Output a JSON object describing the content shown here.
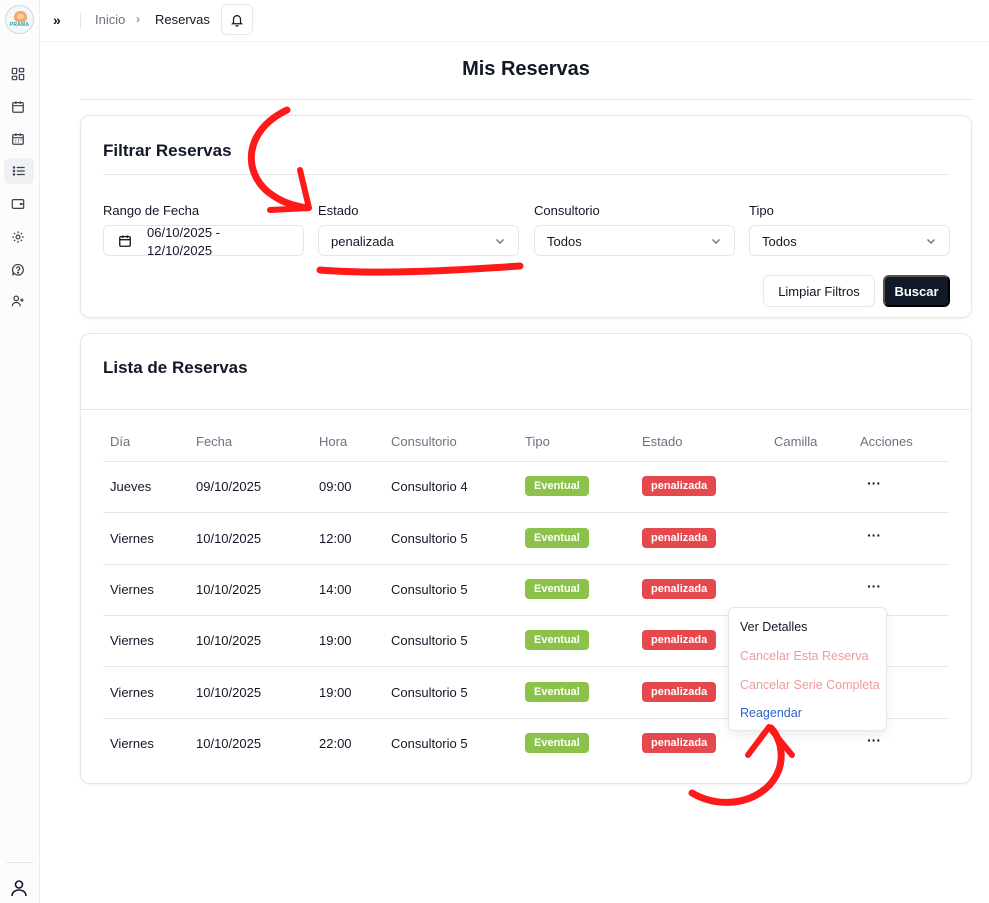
{
  "logo": {
    "brand": "PRAMA"
  },
  "sidebar": {
    "items": [
      {
        "icon": "dashboard-icon"
      },
      {
        "icon": "calendar-icon"
      },
      {
        "icon": "calendar-grid-icon"
      },
      {
        "icon": "list-icon",
        "active": true
      },
      {
        "icon": "wallet-icon"
      },
      {
        "icon": "gear-icon"
      },
      {
        "icon": "help-icon"
      },
      {
        "icon": "user-plus-icon"
      }
    ],
    "bottom_icon": "user-icon"
  },
  "topbar": {
    "expand_label": "»",
    "breadcrumb": [
      "Inicio",
      "Reservas"
    ],
    "separator": "›",
    "bell_icon": "bell-icon"
  },
  "page": {
    "title": "Mis Reservas"
  },
  "filters": {
    "title": "Filtrar Reservas",
    "date_range": {
      "label": "Rango de Fecha",
      "value": "06/10/2025 - 12/10/2025"
    },
    "estado": {
      "label": "Estado",
      "value": "penalizada"
    },
    "consultorio": {
      "label": "Consultorio",
      "value": "Todos"
    },
    "tipo": {
      "label": "Tipo",
      "value": "Todos"
    },
    "clear_label": "Limpiar Filtros",
    "search_label": "Buscar"
  },
  "list": {
    "title": "Lista de Reservas",
    "columns": [
      "Día",
      "Fecha",
      "Hora",
      "Consultorio",
      "Tipo",
      "Estado",
      "Camilla",
      "Acciones"
    ],
    "rows": [
      {
        "dia": "Jueves",
        "fecha": "09/10/2025",
        "hora": "09:00",
        "consultorio": "Consultorio 4",
        "tipo": "Eventual",
        "estado": "penalizada",
        "camilla": ""
      },
      {
        "dia": "Viernes",
        "fecha": "10/10/2025",
        "hora": "12:00",
        "consultorio": "Consultorio 5",
        "tipo": "Eventual",
        "estado": "penalizada",
        "camilla": ""
      },
      {
        "dia": "Viernes",
        "fecha": "10/10/2025",
        "hora": "14:00",
        "consultorio": "Consultorio 5",
        "tipo": "Eventual",
        "estado": "penalizada",
        "camilla": ""
      },
      {
        "dia": "Viernes",
        "fecha": "10/10/2025",
        "hora": "19:00",
        "consultorio": "Consultorio 5",
        "tipo": "Eventual",
        "estado": "penalizada",
        "camilla": ""
      },
      {
        "dia": "Viernes",
        "fecha": "10/10/2025",
        "hora": "19:00",
        "consultorio": "Consultorio 5",
        "tipo": "Eventual",
        "estado": "penalizada",
        "camilla": ""
      },
      {
        "dia": "Viernes",
        "fecha": "10/10/2025",
        "hora": "22:00",
        "consultorio": "Consultorio 5",
        "tipo": "Eventual",
        "estado": "penalizada",
        "camilla": ""
      }
    ],
    "actions_label": "···"
  },
  "actions_menu": {
    "items": [
      "Ver Detalles",
      "Cancelar Esta Reserva",
      "Cancelar Serie Completa",
      "Reagendar"
    ]
  },
  "colors": {
    "tipo_badge": "#8bc34a",
    "estado_badge": "#e5484d",
    "primary_button": "#111827",
    "reschedule_link": "#2f63c9",
    "cancel_text": "#f19a9a",
    "annotation": "#ff1a1a"
  }
}
